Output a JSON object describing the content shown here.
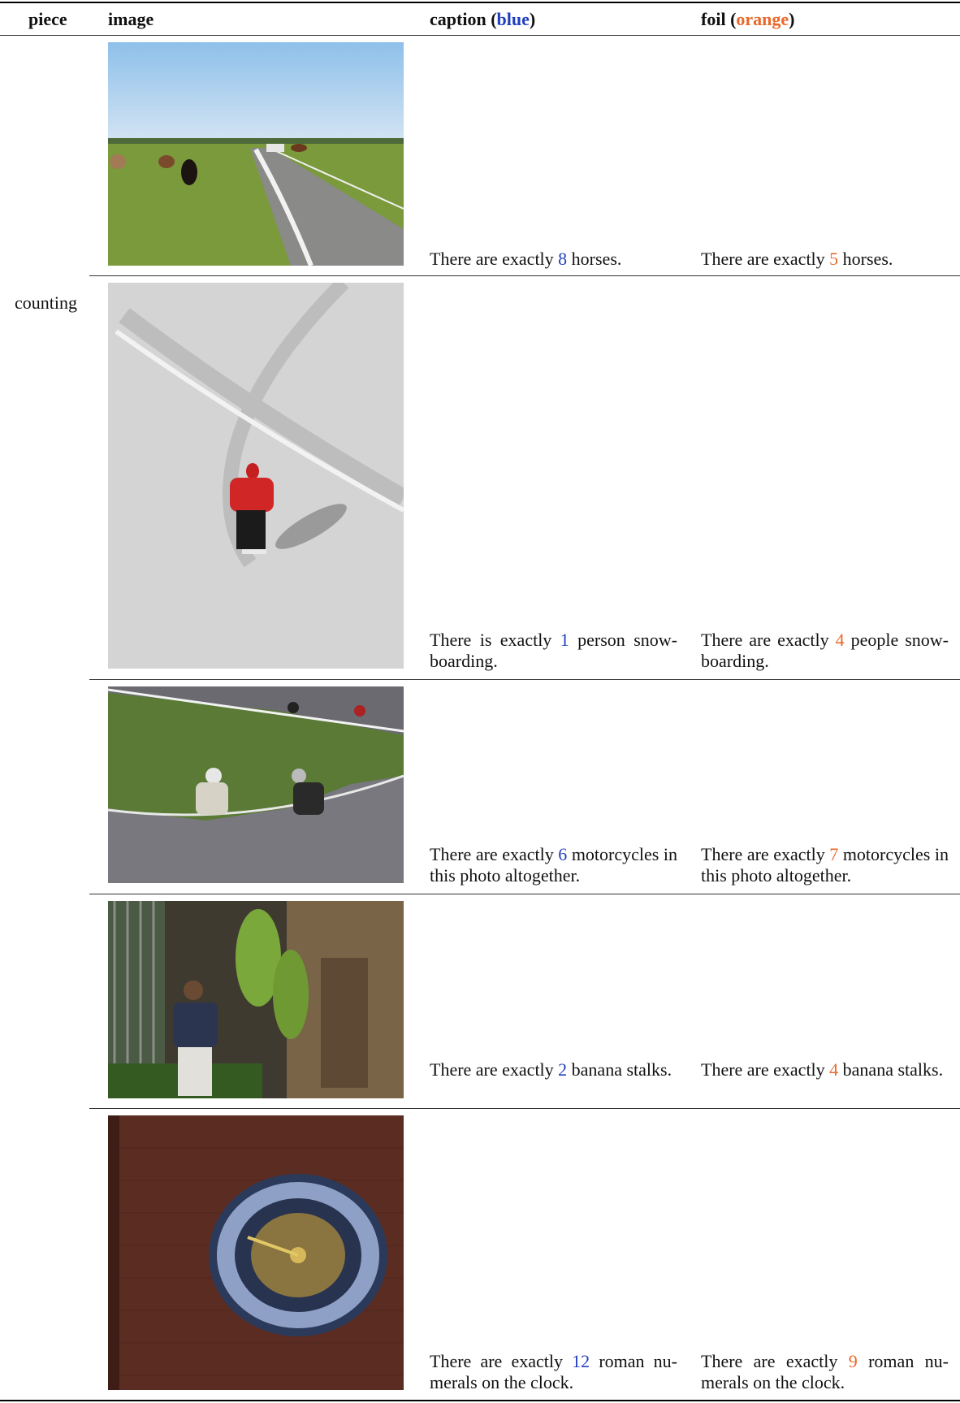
{
  "header": {
    "piece": "piece",
    "image": "image",
    "caption_word": "caption",
    "caption_color": "blue",
    "foil_word": "foil",
    "foil_color": "orange"
  },
  "colors": {
    "caption": "#1f3fbf",
    "foil": "#e8692a"
  },
  "piece": "counting",
  "rows": [
    {
      "image_icon": "horses-on-road-photo",
      "caption": {
        "before": "There are exactly ",
        "num": "8",
        "after": " horses."
      },
      "foil": {
        "before": "There are exactly ",
        "num": "5",
        "after": " horses."
      }
    },
    {
      "image_icon": "snowboarder-photo",
      "caption": {
        "before": "There is exactly ",
        "num": "1",
        "after": " person snow-boarding."
      },
      "foil": {
        "before": "There are exactly ",
        "num": "4",
        "after": " people snow-boarding."
      }
    },
    {
      "image_icon": "motorcycle-race-photo",
      "caption": {
        "before": "There are exactly ",
        "num": "6",
        "after": " motorcycles in this photo altogether."
      },
      "foil": {
        "before": "There are exactly ",
        "num": "7",
        "after": " motorcycles in this photo altogether."
      }
    },
    {
      "image_icon": "banana-vendor-photo",
      "caption": {
        "before": "There are exactly ",
        "num": "2",
        "after": " banana stalks."
      },
      "foil": {
        "before": "There are exactly ",
        "num": "4",
        "after": " banana stalks."
      }
    },
    {
      "image_icon": "wall-clock-photo",
      "caption": {
        "before": "There are exactly ",
        "num": "12",
        "after": " roman nu-merals on the clock."
      },
      "foil": {
        "before": "There are exactly ",
        "num": "9",
        "after": " roman nu-merals on the clock."
      }
    }
  ]
}
